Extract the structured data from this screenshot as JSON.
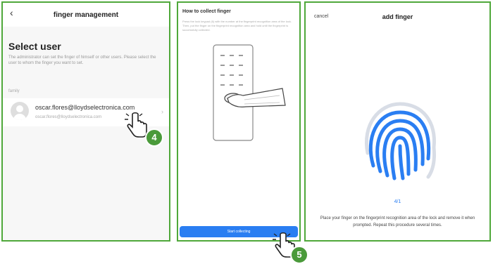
{
  "screen1": {
    "back_icon": "chevron-left-icon",
    "title": "finger management",
    "heading": "Select user",
    "description": "The administrator can set the finger of himself or other users. Please select the user to whom the finger you want to set.",
    "section_label": "family",
    "user": {
      "name": "oscar.flores@lloydselectronica.com",
      "email": "oscar.flores@lloydselectronica.com"
    },
    "step_badge": "4"
  },
  "screen2": {
    "title": "How to collect finger",
    "description": "Press the lock keypad (6) with the number at the fingerprint recognition area of the lock. Then, put the finger on the fingerprint recognition area and hold until the fingerprint is successfully collected.",
    "start_button": "Start collecting",
    "step_badge": "5"
  },
  "screen3": {
    "cancel": "cancel",
    "title": "add finger",
    "progress": "4/1",
    "instruction": "Place your finger on the fingerprint recognition area of the lock and remove it when prompted. Repeat this procedure several times.",
    "accent_color": "#2a7ef2"
  }
}
